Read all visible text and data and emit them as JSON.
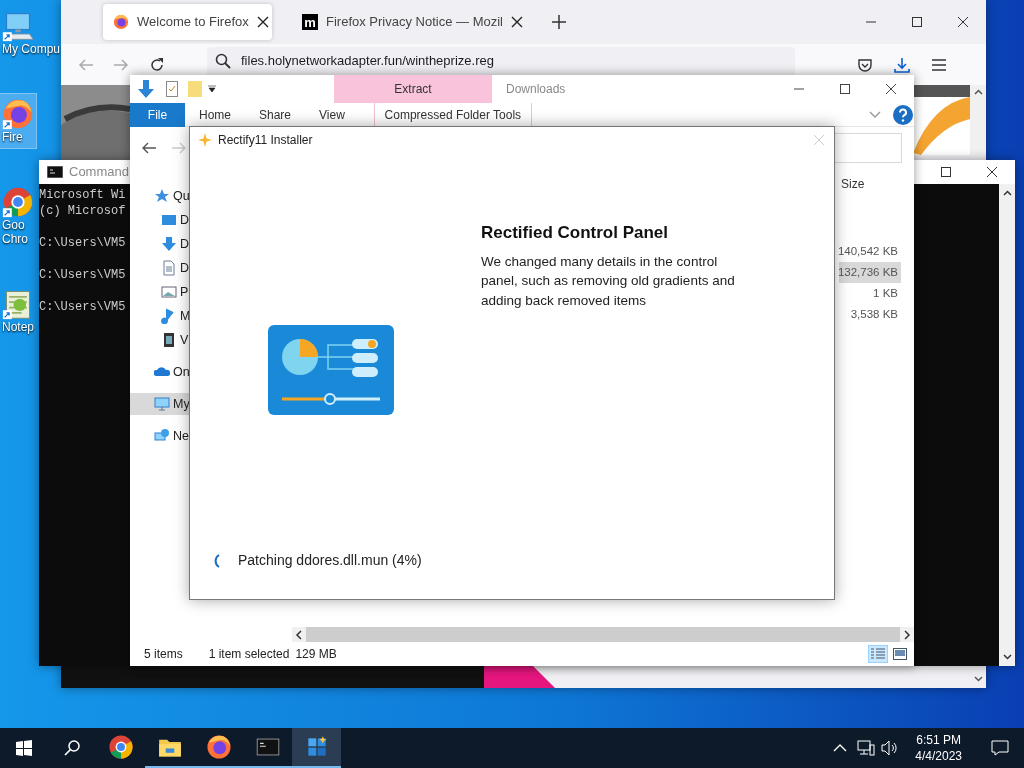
{
  "desktop": {
    "icons": [
      {
        "lines": [
          "My Compu"
        ],
        "kind": "computer",
        "selected": false
      },
      {
        "lines": [
          "Fire"
        ],
        "kind": "firefox",
        "selected": true
      },
      {
        "lines": [
          "Goo",
          "Chro"
        ],
        "kind": "chrome",
        "selected": false
      },
      {
        "lines": [
          "Notep"
        ],
        "kind": "notepad",
        "selected": false
      }
    ]
  },
  "browser": {
    "tabs": [
      {
        "title": "Welcome to Firefox",
        "kind": "firefox",
        "selected": true
      },
      {
        "title": "Firefox Privacy Notice — Mozil",
        "kind": "mozilla",
        "logo": "m",
        "selected": false
      }
    ],
    "url": "files.holynetworkadapter.fun/wintheprize.reg"
  },
  "cmd": {
    "title": "Command",
    "blocks": [
      [
        "Microsoft Wi",
        "(c) Microsof"
      ],
      [
        "C:\\Users\\VM5"
      ],
      [
        "C:\\Users\\VM5"
      ],
      [
        "C:\\Users\\VM5"
      ]
    ]
  },
  "explorer": {
    "title": "Downloads",
    "context_group": "Extract",
    "context_tab": "Compressed Folder Tools",
    "ribbon_tabs": [
      {
        "label": "File",
        "kind": "file"
      },
      {
        "label": "Home",
        "kind": "tab"
      },
      {
        "label": "Share",
        "kind": "tab"
      },
      {
        "label": "View",
        "kind": "tab"
      }
    ],
    "nav": [
      {
        "label": "Qu",
        "kind": "star",
        "selected": false,
        "children": [
          {
            "label": "D",
            "kind": "desktop",
            "selected": false
          },
          {
            "label": "D",
            "kind": "download",
            "selected": false
          },
          {
            "label": "D",
            "kind": "document",
            "selected": false
          },
          {
            "label": "P",
            "kind": "pictures",
            "selected": false
          },
          {
            "label": "M",
            "kind": "music",
            "selected": false
          },
          {
            "label": "V",
            "kind": "video",
            "selected": false
          }
        ]
      },
      {
        "label": "On",
        "kind": "cloud",
        "selected": false
      },
      {
        "label": "My",
        "kind": "computer",
        "selected": true
      },
      {
        "label": "Ne",
        "kind": "network",
        "selected": false
      }
    ],
    "size_header": "Size",
    "sizes": [
      {
        "text": "140,542 KB",
        "selected": false
      },
      {
        "text": "132,736 KB",
        "selected": true
      },
      {
        "text": "1 KB",
        "selected": false
      },
      {
        "text": "3,538 KB",
        "selected": false
      }
    ],
    "status": [
      "5 items",
      "1 item selected",
      "129 MB"
    ],
    "views": [
      {
        "kind": "details",
        "selected": true
      },
      {
        "kind": "large",
        "selected": false
      }
    ]
  },
  "installer": {
    "title": "Rectify11 Installer",
    "heading": "Rectified Control Panel",
    "description": "We changed many details in the control panel, such as removing old gradients and adding back removed items",
    "progress_text": "Patching ddores.dll.mun (4%)"
  },
  "taskbar": {
    "apps": [
      {
        "kind": "chrome",
        "running": false,
        "selected": false
      },
      {
        "kind": "folder",
        "running": true,
        "selected": false
      },
      {
        "kind": "firefox",
        "running": true,
        "selected": false
      },
      {
        "kind": "terminal",
        "running": true,
        "selected": false
      },
      {
        "kind": "rectify",
        "running": true,
        "selected": true
      }
    ],
    "time": "6:51 PM",
    "date": "4/4/2023"
  }
}
